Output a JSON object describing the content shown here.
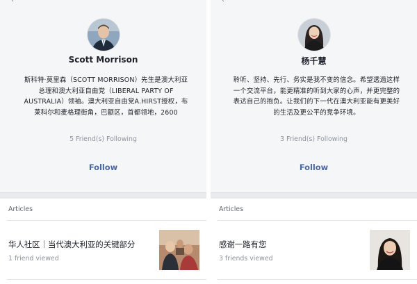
{
  "left": {
    "tick": "`",
    "name": "Scott Morrison",
    "bio": "斯科特·莫里森（SCOTT MORRISON）先生是澳大利亚总理和澳大利亚自由党（LIBERAL PARTY OF AUSTRALIA）领袖。澳大利亚自由党A.HIRST授权，布莱科尔和麦格理街角，巴额区，首都领地，2600",
    "following": "5 Friend(s) Following",
    "follow_label": "Follow",
    "articles_label": "Articles",
    "article": {
      "title": "华人社区｜当代澳大利亚的关键部分",
      "meta": "1 friend viewed"
    }
  },
  "right": {
    "tick": "`",
    "name": "杨千慧",
    "bio": "聆听、坚持、先行、务实是我不变的信念。希望透過这样一个交流平台，能更精准的听到大家的心声，并更完整的表达自己的抱负。让我们的下一代在澳大利亚能有更美好的生活及更公平的竞争环境。",
    "following": "3 Friend(s) Following",
    "follow_label": "Follow",
    "articles_label": "Articles",
    "article": {
      "title": "感谢一路有您",
      "meta": "3 friends viewed"
    }
  },
  "colors": {
    "link": "#4b67a1",
    "muted": "#8d949e",
    "panel_bg": "#f5f6f7",
    "separator": "#e9ebee"
  },
  "icons": {
    "left_avatar": "portrait-man-photo",
    "right_avatar": "portrait-woman-photo",
    "left_thumb": "crowd-photo",
    "right_thumb": "woman-portrait-photo"
  }
}
